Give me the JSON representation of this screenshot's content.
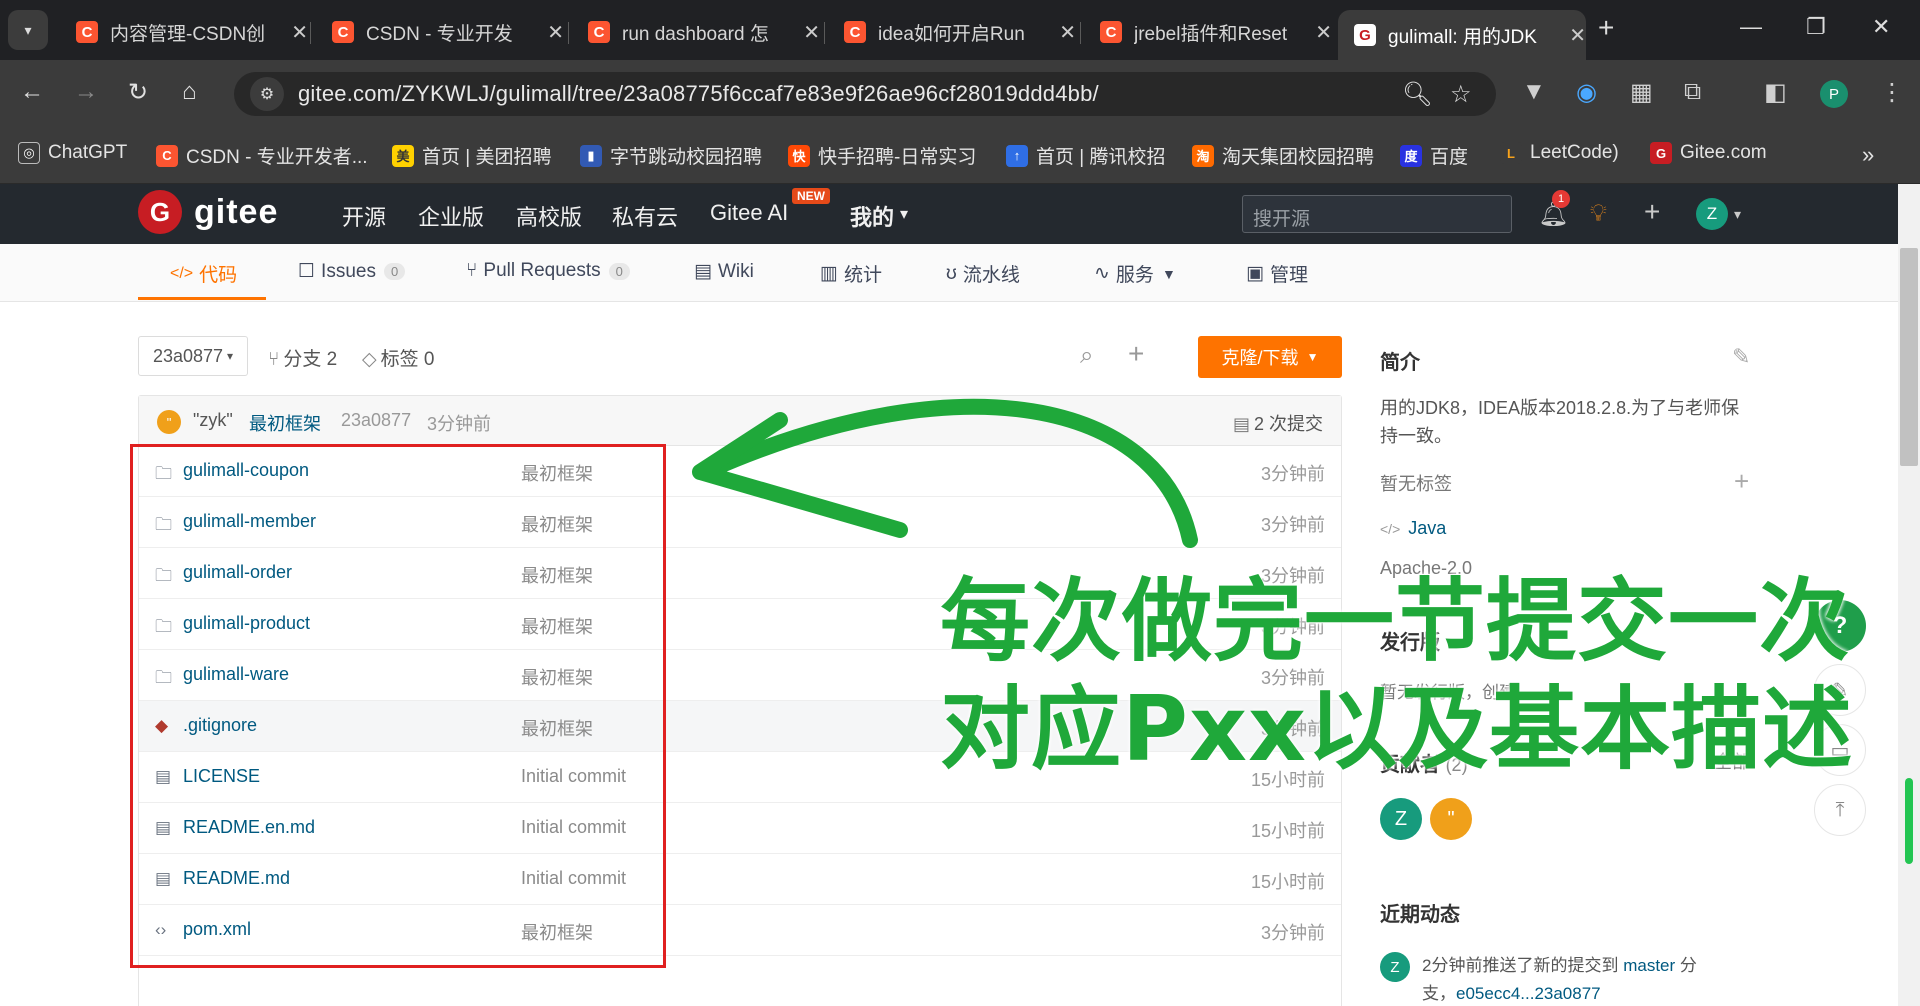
{
  "browser": {
    "tabs": [
      {
        "title": "内容管理-CSDN创",
        "favicon": "C"
      },
      {
        "title": "CSDN - 专业开发",
        "favicon": "C"
      },
      {
        "title": "run dashboard 怎",
        "favicon": "C"
      },
      {
        "title": "idea如何开启Run",
        "favicon": "C"
      },
      {
        "title": "jrebel插件和Reset",
        "favicon": "C"
      },
      {
        "title": "gulimall: 用的JDK",
        "favicon": "G"
      }
    ],
    "url": "gitee.com/ZYKWLJ/gulimall/tree/23a08775f6ccaf7e83e9f26ae96cf28019ddd4bb/",
    "profile_initial": "P",
    "bookmarks": [
      {
        "label": "ChatGPT",
        "icon": "◎",
        "color": "#3b3b3b"
      },
      {
        "label": "CSDN - 专业开发者...",
        "icon": "C",
        "color": "#fc5531"
      },
      {
        "label": "首页 | 美团招聘",
        "icon": "美",
        "color": "#ffd100"
      },
      {
        "label": "字节跳动校园招聘",
        "icon": "▮",
        "color": "#325ab4"
      },
      {
        "label": "快手招聘-日常实习",
        "icon": "快",
        "color": "#ff4906"
      },
      {
        "label": "首页 | 腾讯校招",
        "icon": "↑",
        "color": "#2f6ee5"
      },
      {
        "label": "淘天集团校园招聘",
        "icon": "淘",
        "color": "#ff6a00"
      },
      {
        "label": "百度",
        "icon": "度",
        "color": "#2932e1"
      },
      {
        "label": "LeetCode)",
        "icon": "L",
        "color": "#3b3b3b"
      },
      {
        "label": "Gitee.com",
        "icon": "G",
        "color": "#c71d23"
      }
    ]
  },
  "gitee": {
    "logo_text": "gitee",
    "nav": [
      "开源",
      "企业版",
      "高校版",
      "私有云",
      "Gitee AI",
      "我的"
    ],
    "new_badge": "NEW",
    "search_placeholder": "搜开源",
    "notif_count": "1",
    "avatar_initial": "Z",
    "repo_tabs": [
      {
        "label": "代码",
        "icon": "</>"
      },
      {
        "label": "Issues",
        "icon": "☐",
        "count": "0"
      },
      {
        "label": "Pull Requests",
        "icon": "⑂",
        "count": "0"
      },
      {
        "label": "Wiki",
        "icon": "▤"
      },
      {
        "label": "统计",
        "icon": "▥"
      },
      {
        "label": "流水线",
        "icon": "ʊ"
      },
      {
        "label": "服务",
        "icon": "∿"
      },
      {
        "label": "管理",
        "icon": "▣"
      }
    ],
    "branch": "23a0877",
    "branches": "分支 2",
    "tags": "标签 0",
    "clone_label": "克隆/下载",
    "commit": {
      "author": "\"zyk\"",
      "message": "最初框架",
      "hash": "23a0877",
      "time": "3分钟前",
      "count": "2 次提交",
      "avatar": "\""
    },
    "files": [
      {
        "name": "gulimall-coupon",
        "msg": "最初框架",
        "time": "3分钟前",
        "type": "folder"
      },
      {
        "name": "gulimall-member",
        "msg": "最初框架",
        "time": "3分钟前",
        "type": "folder"
      },
      {
        "name": "gulimall-order",
        "msg": "最初框架",
        "time": "3分钟前",
        "type": "folder"
      },
      {
        "name": "gulimall-product",
        "msg": "最初框架",
        "time": "3分钟前",
        "type": "folder"
      },
      {
        "name": "gulimall-ware",
        "msg": "最初框架",
        "time": "3分钟前",
        "type": "folder"
      },
      {
        "name": ".gitignore",
        "msg": "最初框架",
        "time": "3分钟前",
        "type": "git"
      },
      {
        "name": "LICENSE",
        "msg": "Initial commit",
        "time": "15小时前",
        "type": "doc"
      },
      {
        "name": "README.en.md",
        "msg": "Initial commit",
        "time": "15小时前",
        "type": "doc"
      },
      {
        "name": "README.md",
        "msg": "Initial commit",
        "time": "15小时前",
        "type": "doc"
      },
      {
        "name": "pom.xml",
        "msg": "最初框架",
        "time": "3分钟前",
        "type": "code"
      }
    ],
    "sidebar": {
      "intro_title": "简介",
      "intro_text_1": "用的JDK8，IDEA版本2018.2.8.为了与老师保",
      "intro_text_2": "持一致。",
      "no_tags": "暂无标签",
      "language": "Java",
      "license_partial": "Apache-2.0",
      "release_title": "发行版",
      "release_partial": "暂无发行版，创建",
      "contrib_title": "贡献者",
      "contrib_count": "(2)",
      "contrib_all": "全部",
      "contributors": [
        {
          "initial": "Z",
          "color": "#179b7d"
        },
        {
          "initial": "\"",
          "color": "#f0a01a"
        }
      ],
      "activity_title": "近期动态",
      "activity_1": "2分钟前推送了新的提交到",
      "activity_branch": "master",
      "activity_2": "分",
      "activity_3": "支，",
      "activity_range": "e05ecc4...23a0877"
    }
  },
  "annotation": {
    "line1": "每次做完一节提交一次",
    "line2": "对应Pxx以及基本描述",
    "color": "#1fa83a",
    "box_color": "#e02020"
  }
}
